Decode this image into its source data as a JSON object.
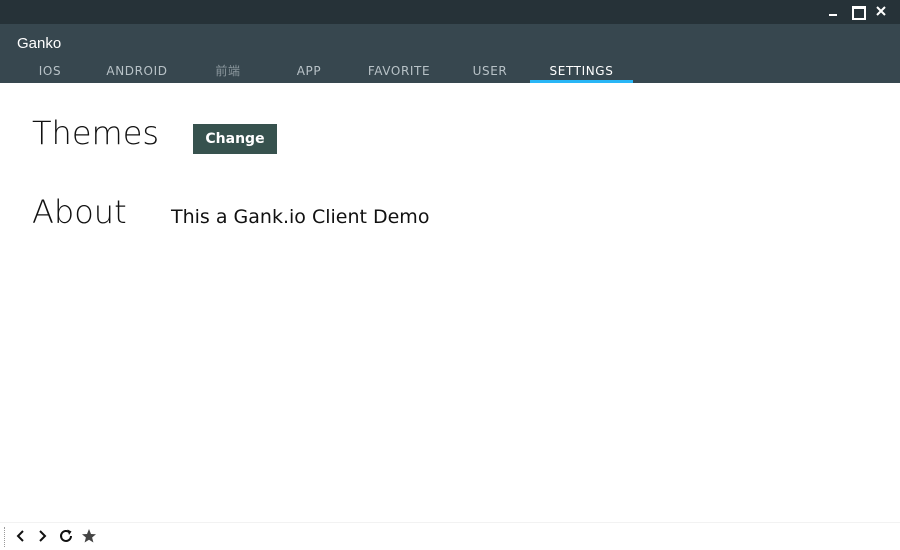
{
  "window": {
    "controls": [
      "minimize-icon",
      "maximize-icon",
      "close-icon"
    ]
  },
  "app": {
    "title": "Ganko"
  },
  "tabs": [
    {
      "label": "IOS",
      "active": false
    },
    {
      "label": "ANDROID",
      "active": false
    },
    {
      "label": "前端",
      "active": false
    },
    {
      "label": "APP",
      "active": false
    },
    {
      "label": "FAVORITE",
      "active": false
    },
    {
      "label": "USER",
      "active": false
    },
    {
      "label": "SETTINGS",
      "active": true
    }
  ],
  "settings": {
    "themes_label": "Themes",
    "change_button": "Change",
    "about_label": "About",
    "about_text": "This a Gank.io Client Demo"
  },
  "bottom_nav": {
    "icons": [
      "back-icon",
      "forward-icon",
      "reload-icon",
      "star-icon"
    ]
  },
  "colors": {
    "titlebar": "#263238",
    "appbar": "#37474f",
    "tab_indicator": "#29b6f6",
    "button": "#37524e"
  }
}
